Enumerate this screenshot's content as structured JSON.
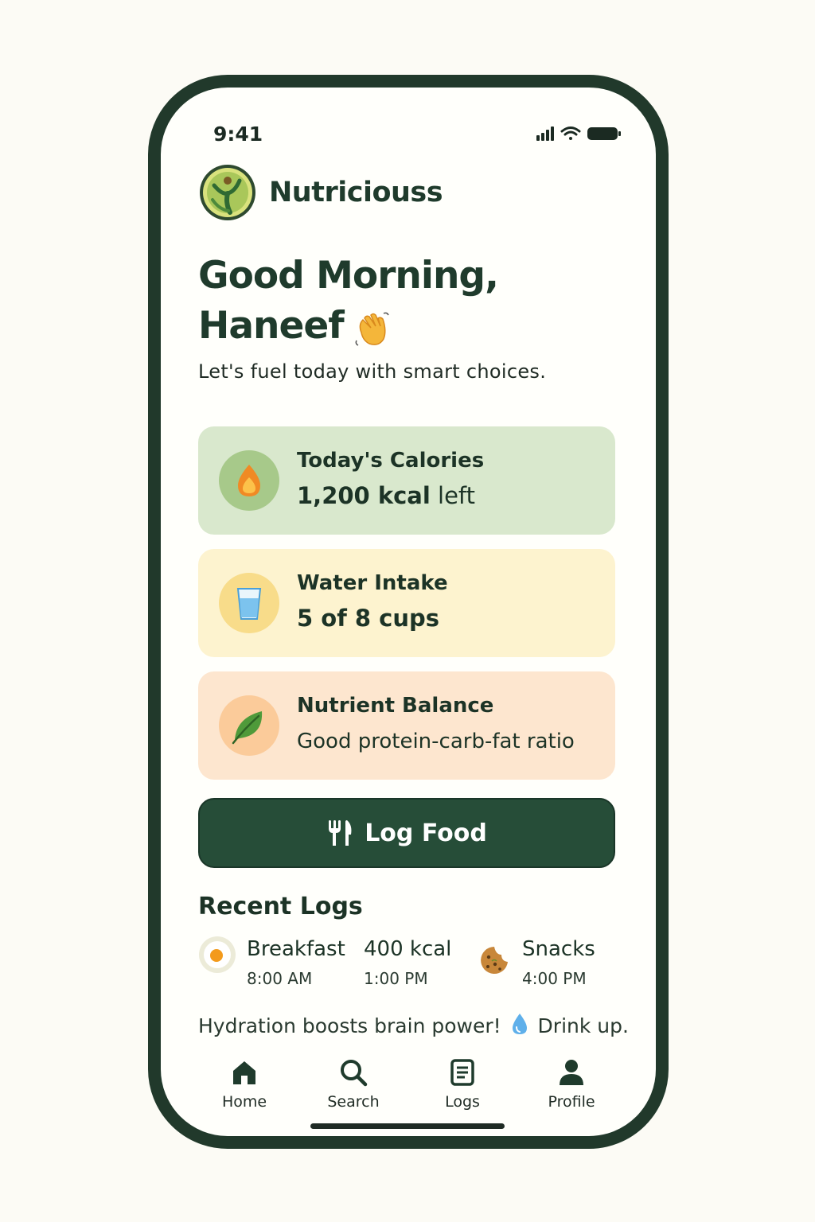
{
  "status_bar": {
    "time": "9:41"
  },
  "app": {
    "name": "Nutriciouss",
    "brand_color": "#264d38"
  },
  "greeting": {
    "line1": "Good Morning,",
    "line2": "Haneef",
    "emoji": "waving-hand-icon",
    "subtitle": "Let's fuel today with smart choices."
  },
  "cards": [
    {
      "title": "Today's Calories",
      "value_bold": "1,200 kcal",
      "value_rest": " left",
      "icon": "flame-icon",
      "bg": "#d9e8cd"
    },
    {
      "title": "Water Intake",
      "value": "5 of 8 cups",
      "icon": "water-glass-icon",
      "bg": "#fdf3cf",
      "progress": {
        "current": 5,
        "total": 8
      }
    },
    {
      "title": "Nutrient Balance",
      "value": "Good protein-carb-fat ratio",
      "icon": "leaf-icon",
      "bg": "#fde6cf"
    }
  ],
  "log_button": {
    "label": "Log Food",
    "icon": "fork-knife-icon"
  },
  "recent_logs": {
    "heading": "Recent Logs",
    "items": [
      {
        "name": "Breakfast",
        "time": "8:00 AM",
        "icon": "fried-egg-icon"
      },
      {
        "name": "400 kcal",
        "time": "1:00 PM"
      },
      {
        "name": "Snacks",
        "time": "4:00 PM",
        "icon": "cookie-icon"
      }
    ]
  },
  "tip": {
    "text_before": "Hydration boosts brain power! ",
    "text_after": " Drink up.",
    "icon": "water-drop-icon"
  },
  "nav": [
    {
      "label": "Home",
      "icon": "home-icon",
      "active": true
    },
    {
      "label": "Search",
      "icon": "search-icon"
    },
    {
      "label": "Logs",
      "icon": "logs-icon"
    },
    {
      "label": "Profile",
      "icon": "profile-icon"
    }
  ]
}
